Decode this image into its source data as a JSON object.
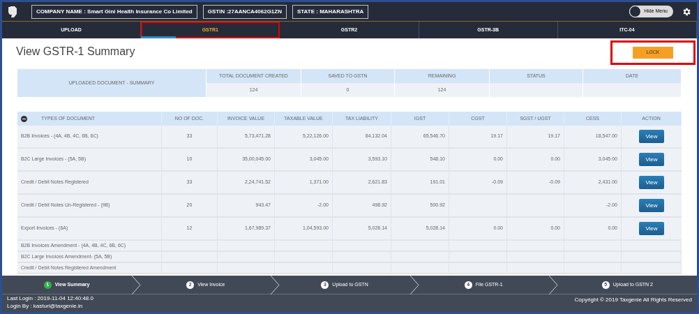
{
  "header": {
    "company": "COMPANY NAME : Smart Gini Health Insurance Co Limited",
    "gstin": "GSTIN :27AANCA4062G1ZN",
    "state": "STATE : MAHARASHTRA",
    "menu_toggle": {
      "label": "Hide Menu",
      "on": false
    }
  },
  "tabs": [
    {
      "label": "UPLOAD",
      "selected": false,
      "highlighted": false
    },
    {
      "label": "GSTR1",
      "selected": true,
      "highlighted": true
    },
    {
      "label": "GSTR2",
      "selected": false,
      "highlighted": false
    },
    {
      "label": "GSTR-3B",
      "selected": false,
      "highlighted": false
    },
    {
      "label": "ITC-04",
      "selected": false,
      "highlighted": false
    }
  ],
  "page_title": "View GSTR-1 Summary",
  "lock_button": {
    "label": "LOCK",
    "highlighted": true
  },
  "summary": {
    "title": "UPLOADED DOCUMENT - SUMMARY",
    "columns": [
      "TOTAL DOCUMENT CREATED",
      "SAVED TO GSTN",
      "REMAINING",
      "STATUS",
      "DATE"
    ],
    "values": [
      "124",
      "0",
      "124"
    ]
  },
  "table": {
    "columns": [
      "TYPES OF DOCUMENT",
      "NO OF DOC.",
      "INVOICE VALUE",
      "TAXABLE VALUE",
      "TAX LIABILITY",
      "IGST",
      "CGST",
      "SGST / UGST",
      "CESS",
      "ACTION"
    ],
    "rows": [
      {
        "kind": "main",
        "type": "B2B Invoices - (4A, 4B, 4C, 6B, 6C)",
        "values": {
          "no_of_doc": "33",
          "invoice_value": "5,73,471.28",
          "taxable_value": "5,22,126.00",
          "tax_liability": "84,132.04",
          "igst": "65,546.70",
          "cgst": "19.17",
          "sgst_ugst": "19.17",
          "cess": "18,547.00"
        },
        "action": "View"
      },
      {
        "kind": "main",
        "type": "B2C Large Invoices - (5A, 5B)",
        "values": {
          "no_of_doc": "10",
          "invoice_value": "35,00,045.00",
          "taxable_value": "3,045.00",
          "tax_liability": "3,593.10",
          "igst": "548.10",
          "cgst": "0.00",
          "sgst_ugst": "0.00",
          "cess": "3,045.00"
        },
        "action": "View"
      },
      {
        "kind": "main",
        "type": "Credit / Debit Notes Registered",
        "values": {
          "no_of_doc": "33",
          "invoice_value": "2,24,741.52",
          "taxable_value": "1,371.00",
          "tax_liability": "2,621.83",
          "igst": "191.01",
          "cgst": "-0.09",
          "sgst_ugst": "-0.09",
          "cess": "2,431.00"
        },
        "action": "View"
      },
      {
        "kind": "main",
        "type": "Credit / Debit Notes Un-Registered - (9B)",
        "values": {
          "no_of_doc": "20",
          "invoice_value": "943.47",
          "taxable_value": "-2.00",
          "tax_liability": "498.92",
          "igst": "500.92",
          "cess": "-2.00"
        },
        "action": "View"
      },
      {
        "kind": "main",
        "type": "Export Invoices - (6A)",
        "values": {
          "no_of_doc": "12",
          "invoice_value": "1,67,989.37",
          "taxable_value": "1,04,593.00",
          "tax_liability": "5,028.14",
          "igst": "5,028.14",
          "cgst": "0.00",
          "sgst_ugst": "0.00",
          "cess": "0.00"
        },
        "action": "View"
      },
      {
        "kind": "amendment",
        "type": "B2B Invoices Amendment - (4A, 4B, 4C, 6B, 6C)"
      },
      {
        "kind": "amendment",
        "type": "B2C Large Invoices Amendment- (5A, 5B)"
      },
      {
        "kind": "amendment",
        "type": "Credit / Debit Notes Registered Amendment"
      }
    ]
  },
  "steps": [
    {
      "number": "1",
      "label": "View Summary",
      "selected": true
    },
    {
      "number": "2",
      "label": "View Invoice",
      "selected": false
    },
    {
      "number": "3",
      "label": "Upload to GSTN",
      "selected": false
    },
    {
      "number": "4",
      "label": "File GSTR-1",
      "selected": false
    },
    {
      "number": "5",
      "label": "Upload to GSTN 2",
      "selected": false
    }
  ],
  "footer": {
    "last_login": "Last Login : 2019-11-04 12:40:48.0",
    "login_by": "Login By : kasturi@taxgenie.in",
    "copyright": "Copyright © 2019 Taxgenie All Rights Reserved"
  }
}
